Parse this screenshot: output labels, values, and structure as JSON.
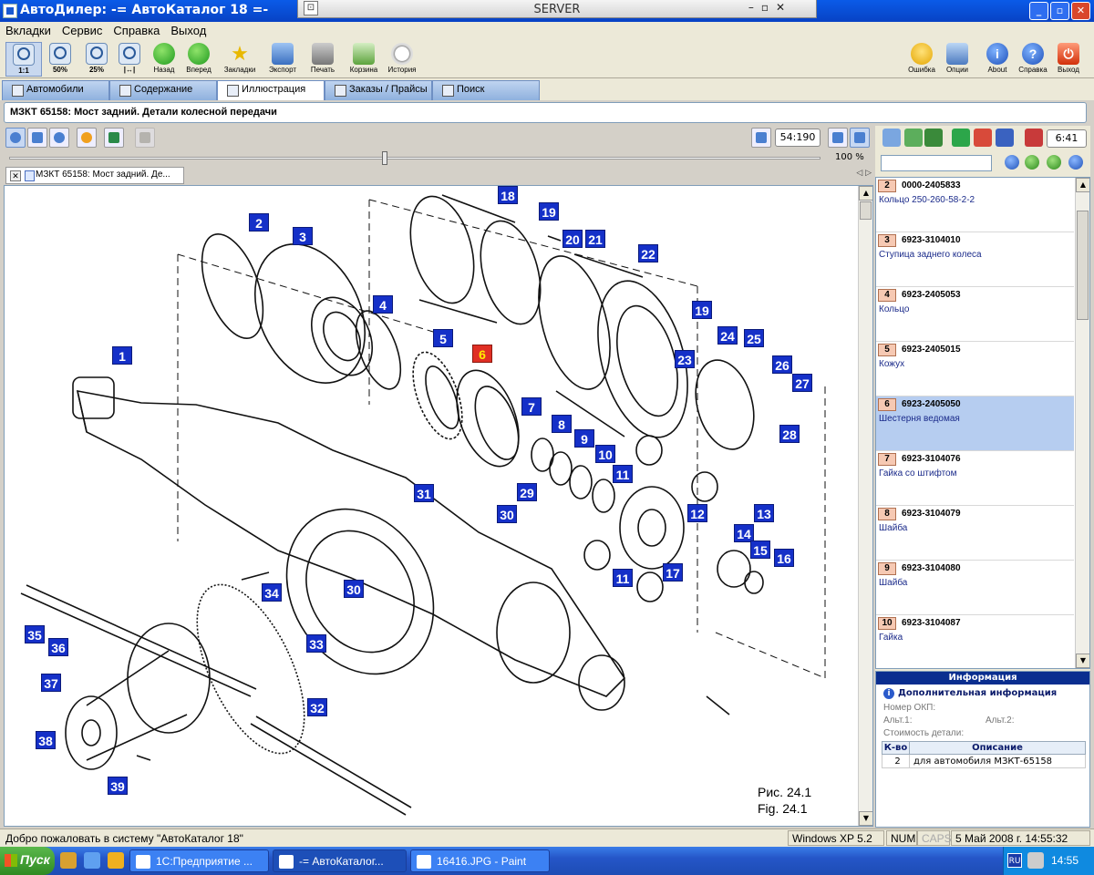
{
  "window": {
    "title": "АвтоДилер: -= АвтоКаталог 18 =-",
    "remote_server": "SERVER"
  },
  "menu": [
    "Вкладки",
    "Сервис",
    "Справка",
    "Выход"
  ],
  "toolbar": {
    "zoom": [
      {
        "label": "1:1",
        "icon": "zoom-1-1-icon"
      },
      {
        "label": "50%",
        "icon": "zoom-50-icon"
      },
      {
        "label": "25%",
        "icon": "zoom-25-icon"
      },
      {
        "label": "",
        "icon": "zoom-fit-icon"
      }
    ],
    "back": "Назад",
    "forward": "Вперед",
    "bookmarks": "Закладки",
    "export": "Экспорт",
    "print": "Печать",
    "cart": "Корзина",
    "history": "История",
    "error": "Ошибка",
    "options": "Опции",
    "about": "About",
    "help": "Справка",
    "exit": "Выход"
  },
  "tabs": [
    {
      "label": "Автомобили",
      "active": false
    },
    {
      "label": "Содержание",
      "active": false
    },
    {
      "label": "Иллюстрация",
      "active": true
    },
    {
      "label": "Заказы / Прайсы",
      "active": false
    },
    {
      "label": "Поиск",
      "active": false
    }
  ],
  "breadcrumb": "МЗКТ 65158: Мост задний. Детали колесной передачи",
  "illustration": {
    "page": "54:190",
    "zoom": "100 %",
    "zoom_fraction": 0.46,
    "doc_tab": "МЗКТ 65158: Мост задний. Де...",
    "caption_ru": "Рис. 24.1",
    "caption_en": "Fig. 24.1",
    "selected_part": "6",
    "callouts": [
      "1",
      "2",
      "3",
      "4",
      "5",
      "6",
      "7",
      "8",
      "9",
      "10",
      "11",
      "11",
      "12",
      "13",
      "14",
      "15",
      "16",
      "17",
      "18",
      "19",
      "19",
      "20",
      "21",
      "22",
      "23",
      "24",
      "25",
      "26",
      "27",
      "28",
      "29",
      "30",
      "30",
      "31",
      "32",
      "33",
      "34",
      "35",
      "36",
      "37",
      "38",
      "39"
    ]
  },
  "parts_panel": {
    "counter": "6:41",
    "search_value": "",
    "parts": [
      {
        "num": "2",
        "code": "0000-2405833",
        "name": "Кольцо 250-260-58-2-2",
        "selected": false
      },
      {
        "num": "3",
        "code": "6923-3104010",
        "name": "Ступица заднего колеса",
        "selected": false
      },
      {
        "num": "4",
        "code": "6923-2405053",
        "name": "Кольцо",
        "selected": false
      },
      {
        "num": "5",
        "code": "6923-2405015",
        "name": "Кожух",
        "selected": false
      },
      {
        "num": "6",
        "code": "6923-2405050",
        "name": "Шестерня ведомая",
        "selected": true
      },
      {
        "num": "7",
        "code": "6923-3104076",
        "name": "Гайка со штифтом",
        "selected": false
      },
      {
        "num": "8",
        "code": "6923-3104079",
        "name": "Шайба",
        "selected": false
      },
      {
        "num": "9",
        "code": "6923-3104080",
        "name": "Шайба",
        "selected": false
      },
      {
        "num": "10",
        "code": "6923-3104087",
        "name": "Гайка",
        "selected": false
      }
    ]
  },
  "info_panel": {
    "header": "Информация",
    "subheader": "Дополнительная информация",
    "okp_label": "Номер ОКП:",
    "alt1_label": "Альт.1:",
    "alt2_label": "Альт.2:",
    "cost_label": "Стоимость детали:",
    "table_headers": [
      "К-во",
      "Описание"
    ],
    "rows": [
      {
        "qty": "2",
        "desc": "для автомобиля МЗКТ-65158"
      }
    ]
  },
  "status": {
    "message": "Добро пожаловать в систему \"АвтоКаталог 18\"",
    "os": "Windows XP 5.2",
    "num": "NUM",
    "caps": "CAPS",
    "datetime": "5 Май 2008 г. 14:55:32"
  },
  "taskbar": {
    "start": "Пуск",
    "tasks": [
      {
        "label": "1С:Предприятие ...",
        "active": false
      },
      {
        "label": "-= АвтоКаталог...",
        "active": true
      },
      {
        "label": "16416.JPG - Paint",
        "active": false
      }
    ],
    "lang": "RU",
    "clock": "14:55"
  },
  "colors": {
    "callout": "#1530c8",
    "callout_selected": "#e02f24",
    "selected_row": "#b6cdf0",
    "xp_title": "#0a5be8"
  }
}
